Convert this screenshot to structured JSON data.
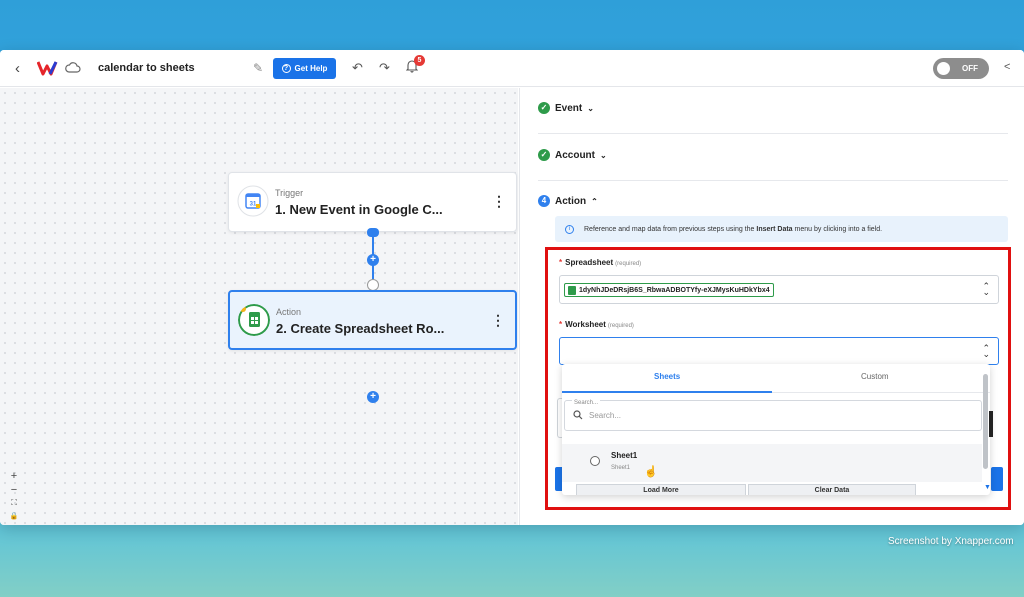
{
  "header": {
    "back": "‹",
    "title": "calendar to sheets",
    "help_label": "Get Help",
    "notifications_count": "5",
    "toggle_label": "OFF"
  },
  "canvas": {
    "nodes": [
      {
        "kind": "Trigger",
        "name": "1. New Event in Google C...",
        "app_icon": "google-calendar-icon"
      },
      {
        "kind": "Action",
        "name": "2. Create Spreadsheet Ro...",
        "app_icon": "google-sheets-icon"
      }
    ],
    "zoom_controls": [
      "+",
      "−",
      "⛶",
      "🔒"
    ]
  },
  "panel": {
    "steps": [
      {
        "label": "Event",
        "status": "complete"
      },
      {
        "label": "Account",
        "status": "complete"
      },
      {
        "label": "Action",
        "status": "active",
        "number": "4"
      }
    ],
    "info_pre": "Reference and map data from previous steps using the",
    "info_bold": "Insert Data",
    "info_post": "menu by clicking into a field.",
    "spreadsheet": {
      "label": "Spreadsheet",
      "hint": "(required)",
      "value": "1dyNhJDeDRsjB6S_RbwaADBOTYfy-eXJMysKuHDkYbx4"
    },
    "worksheet": {
      "label": "Worksheet",
      "hint": "(required)",
      "value": ""
    },
    "dropdown": {
      "tabs": [
        "Sheets",
        "Custom"
      ],
      "search_label": "Search...",
      "search_placeholder": "Search...",
      "options": [
        {
          "title": "Sheet1",
          "subtitle": "Sheet1"
        }
      ],
      "load_more": "Load More",
      "clear_data": "Clear Data"
    }
  },
  "watermark": "Screenshot by Xnapper.com",
  "colors": {
    "accent": "#2f80ed",
    "success": "#2e9b4a",
    "highlight": "#e01010"
  }
}
